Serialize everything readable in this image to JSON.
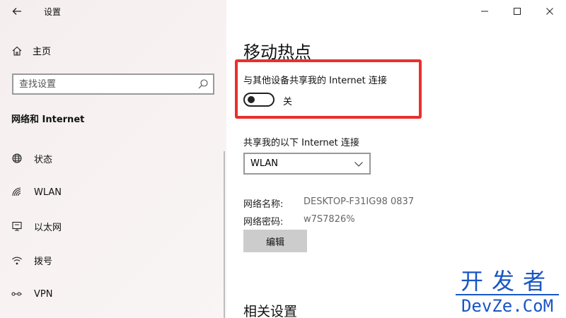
{
  "window": {
    "title": "设置"
  },
  "sidebar": {
    "home_label": "主页",
    "search_placeholder": "查找设置",
    "section_title": "网络和 Internet",
    "items": [
      {
        "label": "状态",
        "icon": "globe-icon"
      },
      {
        "label": "WLAN",
        "icon": "wifi-icon"
      },
      {
        "label": "以太网",
        "icon": "ethernet-icon"
      },
      {
        "label": "拨号",
        "icon": "dialup-icon"
      },
      {
        "label": "VPN",
        "icon": "vpn-icon"
      }
    ]
  },
  "main": {
    "title": "移动热点",
    "share_label": "与其他设备共享我的 Internet 连接",
    "toggle_state": "关",
    "share_from_label": "共享我的以下 Internet 连接",
    "dropdown_value": "WLAN",
    "network_name_label": "网络名称:",
    "network_name_value": "DESKTOP-F31IG98 0837",
    "network_password_label": "网络密码:",
    "network_password_value": "w7S7826%",
    "edit_label": "编辑",
    "related_title": "相关设置"
  },
  "watermark": {
    "top": "开发者",
    "bottom": "DevZe.CoM"
  },
  "colors": {
    "highlight_border": "#e8302c",
    "watermark": "#1a56c4"
  }
}
